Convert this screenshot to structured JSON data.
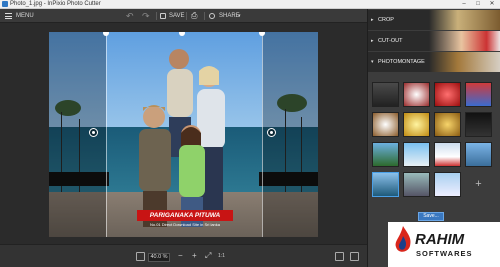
{
  "window": {
    "title": "Photo_1.jpg - InPixio Photo Cutter",
    "min_glyph": "–",
    "max_glyph": "□",
    "close_glyph": "✕"
  },
  "toolbar": {
    "menu_label": "MENU",
    "undo_glyph": "↶",
    "redo_glyph": "↷",
    "save_label": "SAVE",
    "print_glyph": "⎙",
    "share_label": "SHARE",
    "share_caret": "▾"
  },
  "photo": {
    "watermark_title": "PARIGANAKA PITUWA",
    "watermark_sub": "No.01 Direct Download Site in Sri lanka"
  },
  "statusbar": {
    "zoom_value": "40.0 %",
    "zoom_out_glyph": "−",
    "zoom_in_glyph": "+",
    "fit_glyph": "⤢",
    "actual_glyph": "1:1"
  },
  "panel": {
    "sections": [
      {
        "label": "CROP",
        "chevron": "▸"
      },
      {
        "label": "CUT-OUT",
        "chevron": "▸"
      },
      {
        "label": "PHOTOMONTAGE",
        "chevron": "▾"
      }
    ],
    "add_glyph": "+",
    "save_button": "Save..."
  },
  "logo": {
    "name": "RAHIM",
    "sub": "SOFTWARES"
  },
  "colors": {
    "accent": "#3a78c0",
    "watermark": "#c81414",
    "panel_bg": "#3c3c3c",
    "toolbar_bg": "#3a3a3a"
  },
  "icons": [
    "app-icon",
    "menu-icon",
    "undo-icon",
    "redo-icon",
    "save-icon",
    "print-icon",
    "share-icon",
    "zoom-out-icon",
    "zoom-in-icon",
    "fit-icon",
    "actual-size-icon",
    "layout-icon",
    "flame-logo-icon"
  ]
}
